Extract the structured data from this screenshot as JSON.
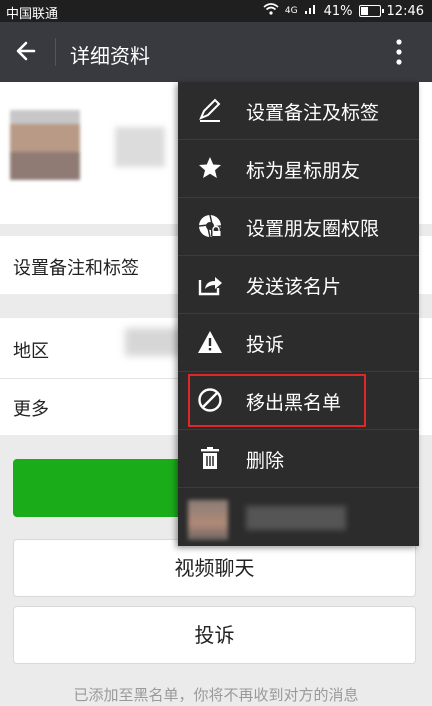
{
  "status_bar": {
    "carrier": "中国联通 ",
    "signal": "4G",
    "battery": "41%",
    "time": "12:46"
  },
  "title_bar": {
    "back_icon": "arrow-left-icon",
    "title": "详细资料",
    "more_icon": "vertical-dots-icon"
  },
  "profile": {
    "rows": [
      {
        "label": "设置备注和标签"
      },
      {
        "label": "地区"
      },
      {
        "label": "更多"
      }
    ]
  },
  "buttons": {
    "video_call": "视频聊天",
    "report": "投诉"
  },
  "note": "已添加至黑名单，你将不再收到对方的消息",
  "menu": {
    "items": [
      {
        "icon": "pencil-icon",
        "label": "设置备注及标签"
      },
      {
        "icon": "star-icon",
        "label": "标为星标朋友"
      },
      {
        "icon": "camera-aperture-icon",
        "label": "设置朋友圈权限"
      },
      {
        "icon": "share-icon",
        "label": "发送该名片"
      },
      {
        "icon": "warning-icon",
        "label": "投诉"
      },
      {
        "icon": "block-icon",
        "label": "移出黑名单"
      },
      {
        "icon": "trash-icon",
        "label": "删除"
      }
    ]
  },
  "colors": {
    "titlebar": "#393a3f",
    "menu_bg": "#2c2c2c",
    "green": "#1aad19",
    "highlight": "#e02626"
  }
}
